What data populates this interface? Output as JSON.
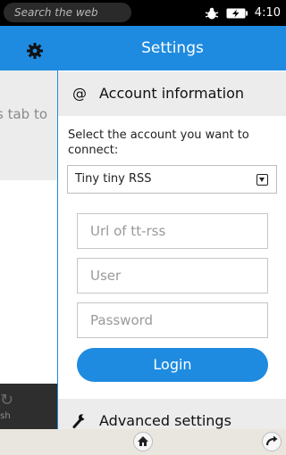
{
  "status_bar": {
    "search_placeholder": "Search the web",
    "time": "4:10",
    "icons": [
      "bug-icon",
      "battery-charging-icon"
    ]
  },
  "background_page": {
    "header_icon": "gear-icon",
    "snippet_text": "s tab to",
    "bottom_icon": "refresh-icon",
    "bottom_label": "esh"
  },
  "settings": {
    "title": "Settings",
    "account_section": {
      "icon": "at-sign-icon",
      "title": "Account information",
      "prompt": "Select the account you want to connect:",
      "selected_account": "Tiny tiny RSS",
      "fields": {
        "url_placeholder": "Url of tt-rss",
        "user_placeholder": "User",
        "password_placeholder": "Password"
      },
      "login_label": "Login"
    },
    "advanced_section": {
      "icon": "wrench-icon",
      "title": "Advanced settings"
    }
  },
  "bottom_bar": {
    "icons": [
      "home-icon",
      "forward-icon"
    ]
  },
  "colors": {
    "accent": "#1e8be0",
    "section_bg": "#ececec",
    "statusbar_bg": "#000000",
    "bottombar_bg": "#e9e6df"
  }
}
